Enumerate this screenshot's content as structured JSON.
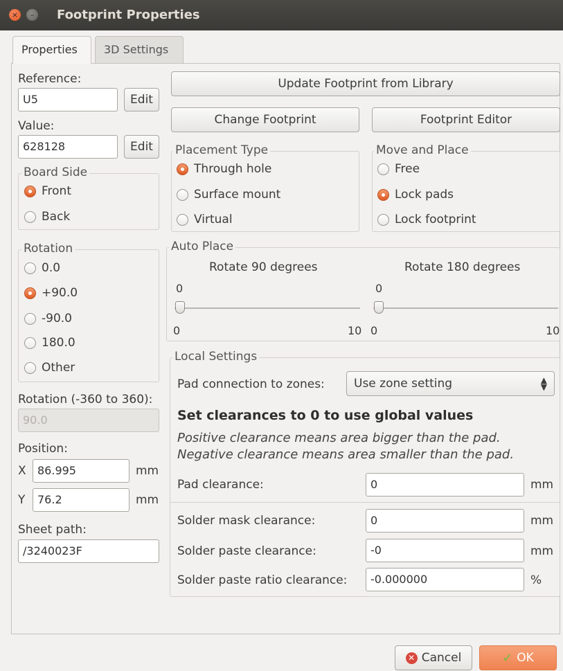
{
  "window": {
    "title": "Footprint Properties"
  },
  "tabs": [
    {
      "label": "Properties",
      "active": true
    },
    {
      "label": "3D Settings",
      "active": false
    }
  ],
  "left": {
    "reference_label": "Reference:",
    "reference_value": "U5",
    "value_label": "Value:",
    "value_value": "628128",
    "edit_label": "Edit",
    "board_side": {
      "title": "Board Side",
      "options": [
        "Front",
        "Back"
      ],
      "selected": "Front"
    },
    "rotation": {
      "title": "Rotation",
      "options": [
        "0.0",
        "+90.0",
        "-90.0",
        "180.0",
        "Other"
      ],
      "selected": "+90.0"
    },
    "rotation_custom_label": "Rotation (-360 to 360):",
    "rotation_custom_value": "90.0",
    "position_label": "Position:",
    "x_label": "X",
    "x_value": "86.995",
    "y_label": "Y",
    "y_value": "76.2",
    "unit": "mm",
    "sheet_path_label": "Sheet path:",
    "sheet_path_value": "/3240023F"
  },
  "right": {
    "update_button": "Update Footprint from Library",
    "change_button": "Change Footprint",
    "editor_button": "Footprint Editor",
    "placement_type": {
      "title": "Placement Type",
      "options": [
        "Through hole",
        "Surface mount",
        "Virtual"
      ],
      "selected": "Through hole"
    },
    "move_place": {
      "title": "Move and Place",
      "options": [
        "Free",
        "Lock pads",
        "Lock footprint"
      ],
      "selected": "Lock pads"
    },
    "auto_place": {
      "title": "Auto Place",
      "rotate90": {
        "label": "Rotate 90 degrees",
        "value": "0",
        "min": "0",
        "max": "10"
      },
      "rotate180": {
        "label": "Rotate 180 degrees",
        "value": "0",
        "min": "0",
        "max": "10"
      }
    },
    "local_settings": {
      "title": "Local Settings",
      "pad_connection_label": "Pad connection to zones:",
      "pad_connection_value": "Use zone setting",
      "heading": "Set clearances to 0 to use global values",
      "hint1": "Positive clearance means area bigger than the pad.",
      "hint2": "Negative clearance means area smaller than the pad.",
      "rows": [
        {
          "label": "Pad clearance:",
          "value": "0",
          "unit": "mm"
        },
        {
          "label": "Solder mask clearance:",
          "value": "0",
          "unit": "mm"
        },
        {
          "label": "Solder paste clearance:",
          "value": "-0",
          "unit": "mm"
        },
        {
          "label": "Solder paste ratio clearance:",
          "value": "-0.000000",
          "unit": "%"
        }
      ]
    }
  },
  "footer": {
    "cancel": "Cancel",
    "ok": "OK"
  }
}
